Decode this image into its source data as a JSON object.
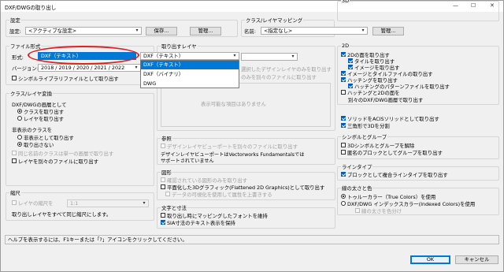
{
  "window": {
    "title": "DXF/DWGの取り出し",
    "min": "—",
    "max": "☐",
    "close": "✕"
  },
  "settings": {
    "group": "設定",
    "label": "設定:",
    "value": "<アクティブな設定>",
    "save": "保存...",
    "manage": "管理..."
  },
  "class_layer_mapping": {
    "group": "クラス/レイヤマッピング",
    "label": "名前:",
    "value": "<指定なし>",
    "manage": "管理..."
  },
  "file_format": {
    "group": "ファイル形式",
    "format_label": "形式:",
    "format_value": "DXF（テキスト）",
    "version_label": "バージョン:",
    "version_value": "2018 / 2019 / 2020 / 2021 / 2022",
    "symbol_check": "シンボルライブラリファイルとして取り出す",
    "options": [
      "DXF（テキスト）",
      "DXF（バイナリ）",
      "DWG"
    ]
  },
  "export_layers": {
    "group": "取り出すレイヤ",
    "select_placeholder": "",
    "select_extra": "選択したデザインレイヤのみを取り出す",
    "extra_item": "のみを別々のファイルに取り出す",
    "empty": "表示可能な項目はありません"
  },
  "class_layer_convert": {
    "group": "クラス/レイヤ変換",
    "dxf_layer_label": "DXF/DWGの画層として",
    "radio1": "クラスを取り出す",
    "radio2": "レイヤを取り出す",
    "hidden_label": "非表示のクラスを",
    "hidden_r1": "非表示として取り出す",
    "hidden_r2": "取り出さない",
    "same_name": "同じ名前のクラスは単一の画層で取り出す",
    "layer_files": "レイヤを別々のファイルに取り出す"
  },
  "reference": {
    "group": "参照",
    "item1": "デザインレイヤビューポートを別々のファイルに取り出す",
    "note": "デザインレイヤビューポートはVectorworks Fundamentalsではサポートされていません"
  },
  "graphics": {
    "group": "図形",
    "item1": "確認されている図形のみを取り出す",
    "item2": "平面化した3Dグラフィック(Flattened 2D Graphics)として取り出す",
    "item3": "データの可視化を使用して属性を上書きする"
  },
  "text_dimension": {
    "group": "文字と寸法",
    "item1": "取り出し時にマッピングしたフォントを維持",
    "item2": "SIA寸法のテキスト表示を保持"
  },
  "scale": {
    "group": "縮尺",
    "check": "レイヤの縮尺を",
    "value": "1:1",
    "note": "取り出しレイヤをすべて同じ縮尺にします。"
  },
  "twod": {
    "group": "2D",
    "items": [
      "2Dの面を取り出す",
      "タイルを取り出す",
      "イメージを取り出す",
      "イメージとタイルファイルの取り出す",
      "ハッチングを取り出す",
      "ハッチングのパターンファイルを取り出す",
      "ハッチングと2Dの面を",
      "別々のDXF/DWG画層で取り出す"
    ]
  },
  "threed": {
    "group": "3D",
    "items": [
      "ソリッドをACISソリッドとして取り出す",
      "三角形で3Dを分割"
    ]
  },
  "symbols": {
    "group": "シンボルとグループ",
    "items": [
      "3Dシンボルとグループを解除",
      "匿名のブロックとしてグループを取り出す"
    ]
  },
  "linetype": {
    "group": "ラインタイプ",
    "items": [
      "ブロックとして複合ラインタイプを取り出す"
    ]
  },
  "line_color": {
    "group": "線の太さと色",
    "r1": "トゥルーカラー（True Colors）を使用",
    "r2": "DXF/DWG インデックスカラー(Indexed Colors)を使用",
    "sub": "線の太さを色分け"
  },
  "status": "ヘルプを表示するには、F1キーまたは「?」アイコンをクリックしてください。",
  "buttons": {
    "ok": "OK",
    "cancel": "キャンセル"
  }
}
